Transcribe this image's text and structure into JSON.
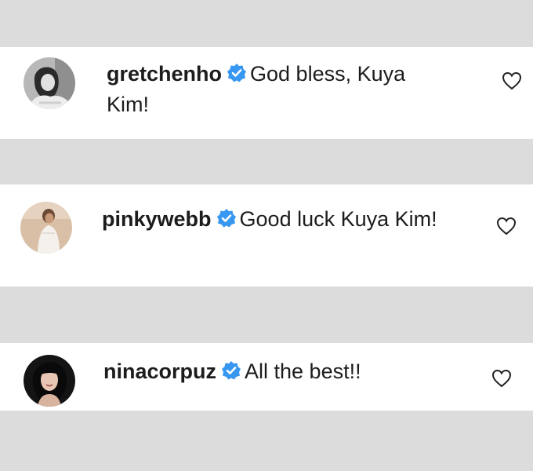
{
  "comments": [
    {
      "username": "gretchenho",
      "verified": true,
      "text": "God bless, Kuya Kim!"
    },
    {
      "username": "pinkywebb",
      "verified": true,
      "text": "Good luck Kuya Kim!"
    },
    {
      "username": "ninacorpuz",
      "verified": true,
      "text": "All the best!!"
    }
  ],
  "icons": {
    "verified": "verified-badge-icon",
    "like": "heart-outline-icon"
  },
  "colors": {
    "background": "#dcdcdc",
    "card": "#ffffff",
    "text": "#1c1c1c",
    "verified": "#3897f0"
  }
}
